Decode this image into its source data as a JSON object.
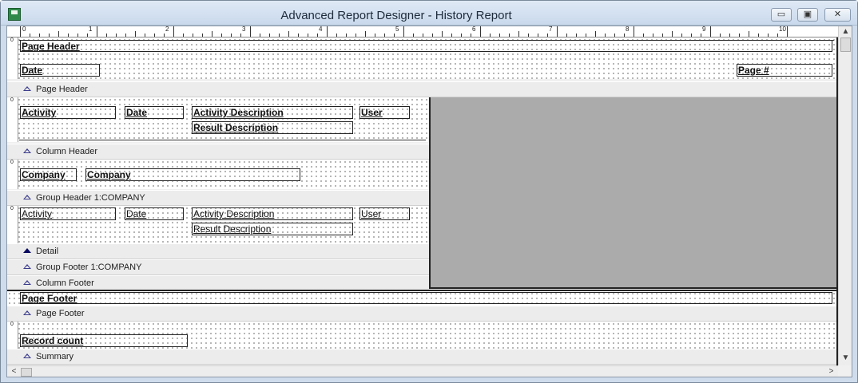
{
  "window": {
    "title": "Advanced Report Designer - History Report",
    "minimize": "▭",
    "maximize": "▣",
    "close": "✕"
  },
  "ruler": {
    "zero": "0",
    "labels": [
      "1",
      "2",
      "3",
      "4",
      "5",
      "6",
      "7",
      "8",
      "9",
      "10"
    ]
  },
  "page_header": {
    "title": "Page Header",
    "date": "Date",
    "page_num": "Page #",
    "section": "Page Header"
  },
  "column_header": {
    "activity": "Activity",
    "date": "Date",
    "activity_desc": "Activity Description",
    "user": "User",
    "result_desc": "Result Description",
    "section": "Column Header"
  },
  "group_header": {
    "company_label": "Company",
    "company_field": "Company",
    "section": "Group Header 1:COMPANY"
  },
  "detail": {
    "activity": "Activity",
    "date": "Date",
    "activity_desc": "Activity Description",
    "user": "User",
    "result_desc": "Result Description",
    "section": "Detail"
  },
  "group_footer": {
    "section": "Group Footer 1:COMPANY"
  },
  "column_footer": {
    "section": "Column Footer"
  },
  "page_footer": {
    "title": "Page Footer",
    "section": "Page Footer"
  },
  "summary": {
    "record_count": "Record count",
    "section": "Summary"
  },
  "scroll": {
    "up": "▲",
    "down": "▼",
    "left": "<",
    "right": ">"
  }
}
